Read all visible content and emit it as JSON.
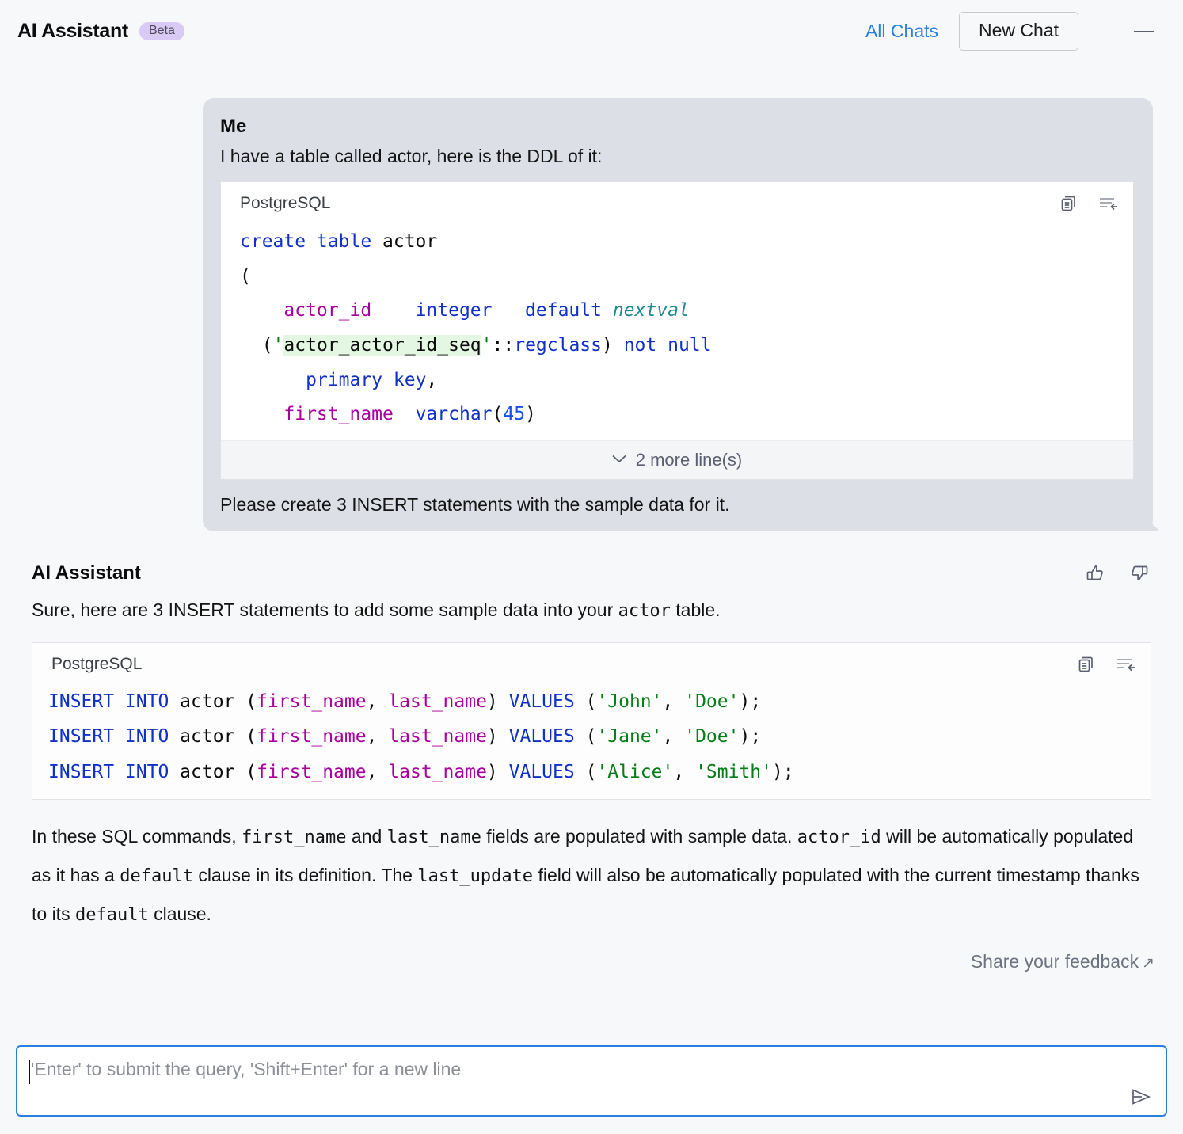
{
  "header": {
    "title": "AI Assistant",
    "badge": "Beta",
    "all_chats_label": "All Chats",
    "new_chat_label": "New Chat",
    "menu_icon": "kebab-menu-icon",
    "minimize_icon": "minimize-icon",
    "link_color": "#2b7fe0"
  },
  "user_message": {
    "sender": "Me",
    "menu_icon": "kebab-menu-icon",
    "text_before": "I have a table called actor, here is the DDL of it:",
    "text_after": "Please create 3 INSERT statements with the sample data for it.",
    "code": {
      "language": "PostgreSQL",
      "copy_icon": "copy-icon",
      "insert_icon": "insert-into-editor-icon",
      "lines": [
        "create table actor",
        "(",
        "    actor_id    integer   default nextval",
        "  ('actor_actor_id_seq'::regclass) not null",
        "      primary key,",
        "    first_name  varchar(45)"
      ],
      "collapsed_label": "2 more line(s)",
      "collapsed_count": 2
    }
  },
  "assistant_message": {
    "sender": "AI Assistant",
    "thumbs_up_icon": "thumbs-up-icon",
    "thumbs_down_icon": "thumbs-down-icon",
    "intro_part1": "Sure, here are 3 INSERT statements to add some sample data into your ",
    "intro_code": "actor",
    "intro_part2": " table.",
    "code": {
      "language": "PostgreSQL",
      "copy_icon": "copy-icon",
      "insert_icon": "insert-into-editor-icon",
      "statements": [
        {
          "keyword": "INSERT INTO",
          "table": "actor",
          "columns": "first_name, last_name",
          "values": "'John', 'Doe'"
        },
        {
          "keyword": "INSERT INTO",
          "table": "actor",
          "columns": "first_name, last_name",
          "values": "'Jane', 'Doe'"
        },
        {
          "keyword": "INSERT INTO",
          "table": "actor",
          "columns": "first_name, last_name",
          "values": "'Alice', 'Smith'"
        }
      ]
    },
    "explanation": {
      "s1": "In these SQL commands, ",
      "c1": "first_name",
      "s2": " and ",
      "c2": "last_name",
      "s3": " fields are populated with sample data. ",
      "c3": "actor_id",
      "s4": " will be automatically populated as it has a ",
      "c4": "default",
      "s5": " clause in its definition. The ",
      "c5": "last_update",
      "s6": " field will also be automatically populated with the current timestamp thanks to its ",
      "c6": "default",
      "s7": " clause."
    }
  },
  "footer": {
    "share_feedback_label": "Share your feedback",
    "external_link_icon": "external-link-icon"
  },
  "input": {
    "placeholder": "'Enter' to submit the query, 'Shift+Enter' for a new line",
    "value": "",
    "send_icon": "send-icon",
    "focus_color": "#2b7fe0"
  },
  "syntax_colors": {
    "keyword": "#1030c8",
    "column": "#a8009c",
    "string": "#067d17",
    "number": "#1750eb",
    "cast": "#1f8a8f",
    "highlight_bg": "#e3f7e3"
  }
}
